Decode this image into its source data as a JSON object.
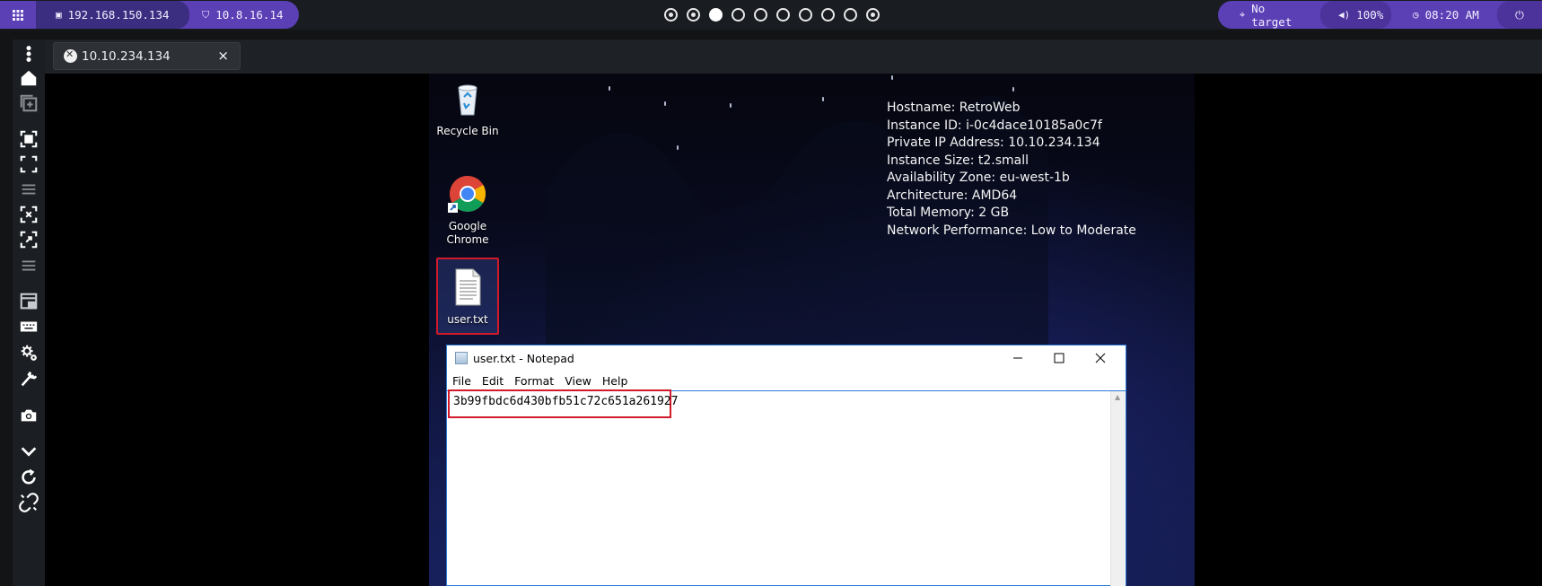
{
  "topbar": {
    "menu_icon": "grid-icon",
    "ip1": "192.168.150.134",
    "ip2": "10.8.16.14",
    "target": "No target",
    "volume": "100%",
    "clock": "08:20 AM",
    "workspace_dots": [
      "ring",
      "ring",
      "filled",
      "empty",
      "empty",
      "empty",
      "empty",
      "empty",
      "empty",
      "ring"
    ]
  },
  "tab": {
    "label": "10.10.234.134",
    "close": "×"
  },
  "sidebar": {
    "items": [
      "more-vertical-icon",
      "home-icon",
      "new-window-icon",
      "focus-icon",
      "fullscreen-icon",
      "separator",
      "scale-icon",
      "expand-icon",
      "separator",
      "screen-icon",
      "keyboard-icon",
      "settings-icon",
      "wrench-icon",
      "camera-icon",
      "chevron-down-icon",
      "refresh-icon",
      "disconnect-icon"
    ]
  },
  "desktop": {
    "icons": [
      {
        "label": "Recycle Bin"
      },
      {
        "label_line1": "Google",
        "label_line2": "Chrome"
      },
      {
        "label": "user.txt"
      }
    ],
    "sysinfo": [
      "Hostname: RetroWeb",
      "Instance ID: i-0c4dace10185a0c7f",
      "Private IP Address: 10.10.234.134",
      "Instance Size: t2.small",
      "Availability Zone: eu-west-1b",
      "Architecture: AMD64",
      "Total Memory: 2 GB",
      "Network Performance: Low to Moderate"
    ]
  },
  "notepad": {
    "title": "user.txt - Notepad",
    "menu": [
      "File",
      "Edit",
      "Format",
      "View",
      "Help"
    ],
    "content": "3b99fbdc6d430bfb51c72c651a261927",
    "highlight_color": "#d11a2a"
  },
  "colors": {
    "accent": "#5b3fb5",
    "accent_dark": "#3b2d80"
  }
}
